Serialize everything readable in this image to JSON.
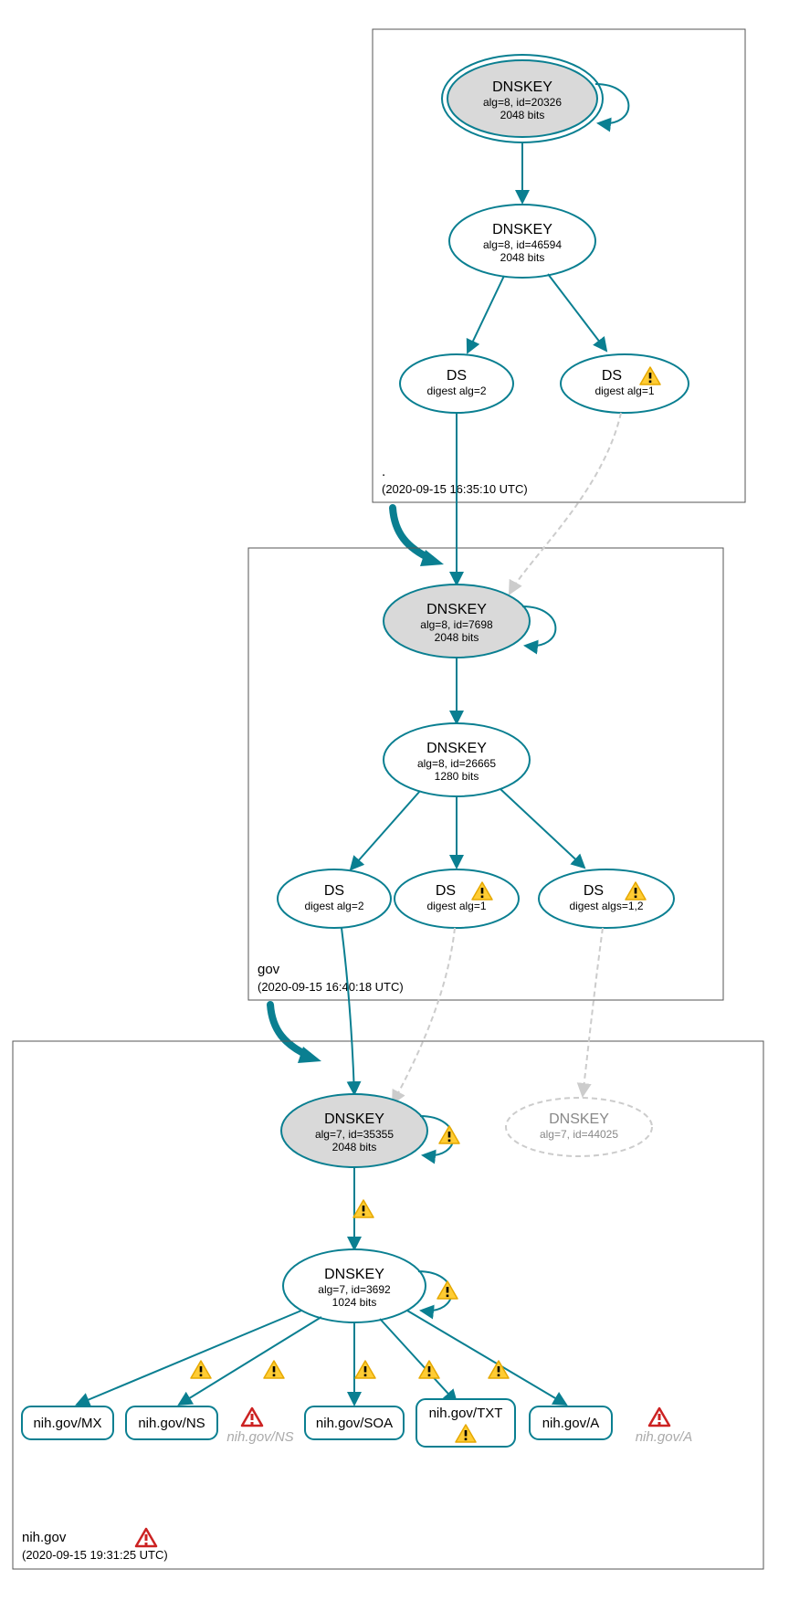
{
  "zones": {
    "root": {
      "label": ".",
      "timestamp": "(2020-09-15 16:35:10 UTC)"
    },
    "gov": {
      "label": "gov",
      "timestamp": "(2020-09-15 16:40:18 UTC)"
    },
    "nihgov": {
      "label": "nih.gov",
      "timestamp": "(2020-09-15 19:31:25 UTC)"
    }
  },
  "nodes": {
    "root_ksk": {
      "title": "DNSKEY",
      "line2": "alg=8, id=20326",
      "line3": "2048 bits"
    },
    "root_zsk": {
      "title": "DNSKEY",
      "line2": "alg=8, id=46594",
      "line3": "2048 bits"
    },
    "root_ds1": {
      "title": "DS",
      "line2": "digest alg=2"
    },
    "root_ds2": {
      "title": "DS",
      "line2": "digest alg=1"
    },
    "gov_ksk": {
      "title": "DNSKEY",
      "line2": "alg=8, id=7698",
      "line3": "2048 bits"
    },
    "gov_zsk": {
      "title": "DNSKEY",
      "line2": "alg=8, id=26665",
      "line3": "1280 bits"
    },
    "gov_ds1": {
      "title": "DS",
      "line2": "digest alg=2"
    },
    "gov_ds2": {
      "title": "DS",
      "line2": "digest alg=1"
    },
    "gov_ds3": {
      "title": "DS",
      "line2": "digest algs=1,2"
    },
    "nih_ksk": {
      "title": "DNSKEY",
      "line2": "alg=7, id=35355",
      "line3": "2048 bits"
    },
    "nih_missing": {
      "title": "DNSKEY",
      "line2": "alg=7, id=44025"
    },
    "nih_zsk": {
      "title": "DNSKEY",
      "line2": "alg=7, id=3692",
      "line3": "1024 bits"
    }
  },
  "rrsets": {
    "mx": "nih.gov/MX",
    "ns": "nih.gov/NS",
    "ns_err": "nih.gov/NS",
    "soa": "nih.gov/SOA",
    "txt": "nih.gov/TXT",
    "a": "nih.gov/A",
    "a_err": "nih.gov/A"
  },
  "icons": {
    "warn": "warning-icon",
    "err": "error-icon"
  }
}
